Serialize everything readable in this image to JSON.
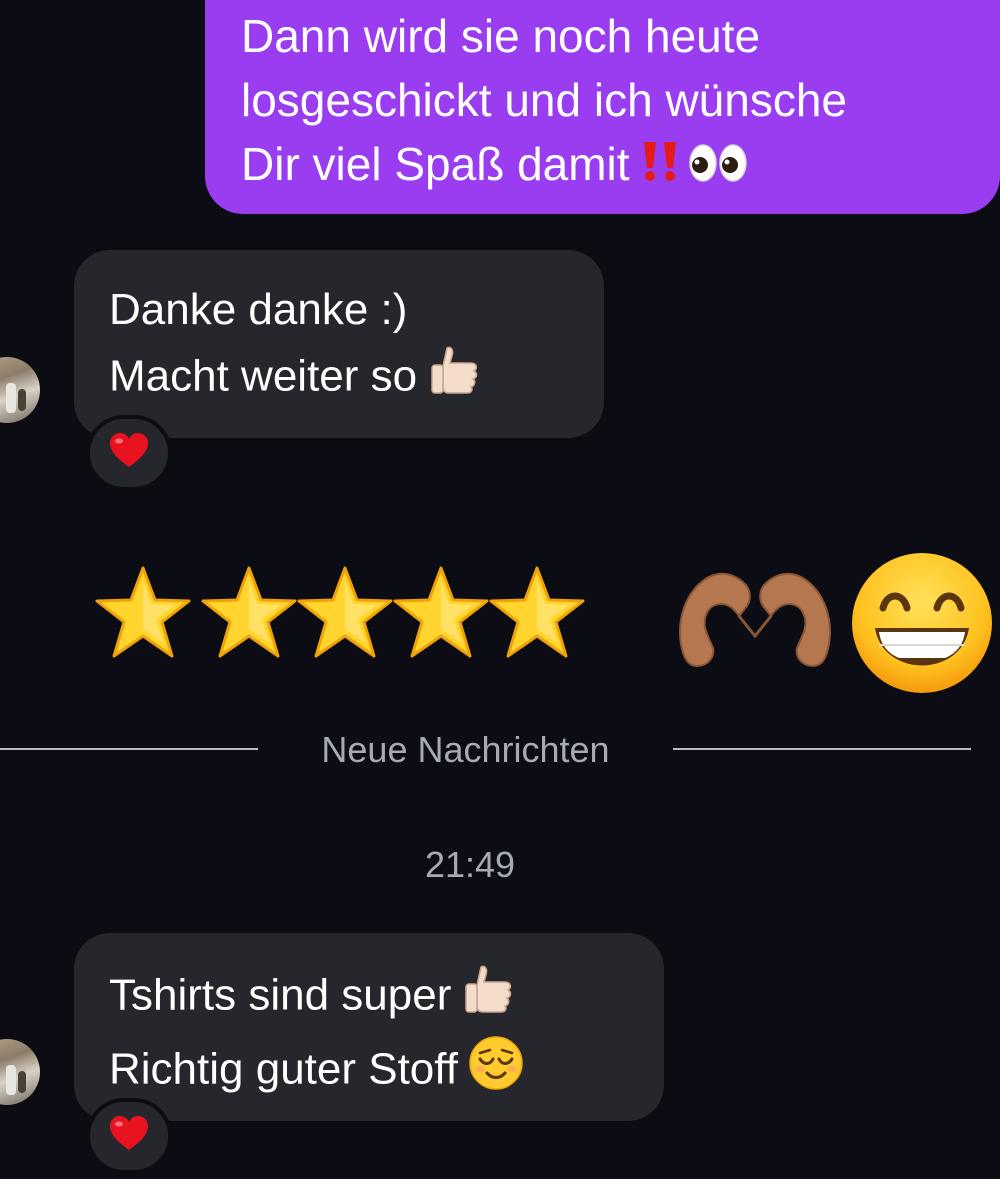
{
  "outgoing_message": {
    "lines": [
      "Dann wird sie noch heute",
      "losgeschickt und ich wünsche",
      "Dir viel Spaß damit"
    ],
    "trailing_emojis": [
      "double-exclamation-icon",
      "eyes-icon"
    ]
  },
  "incoming_messages": [
    {
      "lines": [
        "Danke danke :)",
        "Macht weiter so"
      ],
      "trailing_emojis": [
        null,
        "thumbs-up-icon"
      ],
      "reaction": "heart-icon"
    },
    {
      "lines": [
        "Tshirts sind super",
        "Richtig guter Stoff"
      ],
      "trailing_emojis": [
        "thumbs-up-icon",
        "relieved-face-icon"
      ],
      "reaction": "heart-icon"
    }
  ],
  "rating": {
    "stars": 5,
    "max_stars": 5,
    "extra_emojis": [
      "heart-hands-icon",
      "grinning-face-icon"
    ]
  },
  "divider": {
    "label": "Neue Nachrichten"
  },
  "timestamp": "21:49",
  "colors": {
    "background": "#0b0c14",
    "outgoing_bubble": "#9a3df1",
    "incoming_bubble": "#26272c",
    "meta_text": "#a6aab5"
  }
}
